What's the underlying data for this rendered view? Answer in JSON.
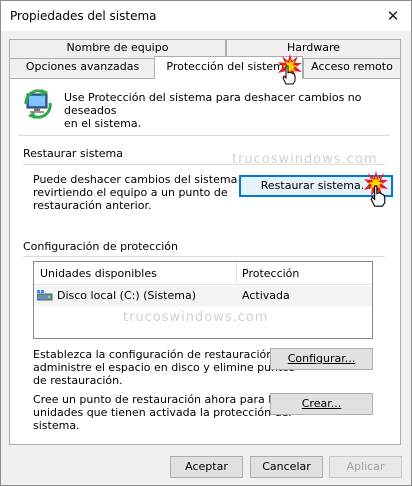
{
  "window": {
    "title": "Propiedades del sistema",
    "close_glyph": "✕"
  },
  "tabs": {
    "row1": [
      "Nombre de equipo",
      "Hardware"
    ],
    "row2": [
      "Opciones avanzadas",
      "Protección del sistema",
      "Acceso remoto"
    ],
    "active": "Protección del sistema"
  },
  "intro": {
    "icon": "system-protection-icon",
    "text_line1": "Use Protección del sistema para deshacer cambios no deseados",
    "text_line2": "en el sistema."
  },
  "restore": {
    "heading": "Restaurar sistema",
    "desc_line1": "Puede deshacer cambios del sistema",
    "desc_line2": "revirtiendo el equipo a un punto de",
    "desc_line3": "restauración anterior.",
    "button": "Restaurar sistema..."
  },
  "protection": {
    "heading": "Configuración de protección",
    "columns": [
      "Unidades disponibles",
      "Protección"
    ],
    "rows": [
      {
        "drive": "Disco local (C:) (Sistema)",
        "status": "Activada",
        "icon": "drive-icon"
      }
    ],
    "configure_desc_line1": "Establezca la configuración de restauración,",
    "configure_desc_line2": "administre el espacio en disco y elimine puntos",
    "configure_desc_line3": "de restauración.",
    "configure_button": "Configurar...",
    "create_desc_line1": "Cree un punto de restauración ahora para las",
    "create_desc_line2": "unidades que tienen activada la protección del",
    "create_desc_line3": "sistema.",
    "create_button": "Crear..."
  },
  "footer": {
    "ok": "Aceptar",
    "cancel": "Cancelar",
    "apply": "Aplicar"
  },
  "watermark": "trucoswindows.com",
  "colors": {
    "focus_border": "#0078d7",
    "burst_red": "#e31e24",
    "burst_yellow": "#ffd400"
  }
}
